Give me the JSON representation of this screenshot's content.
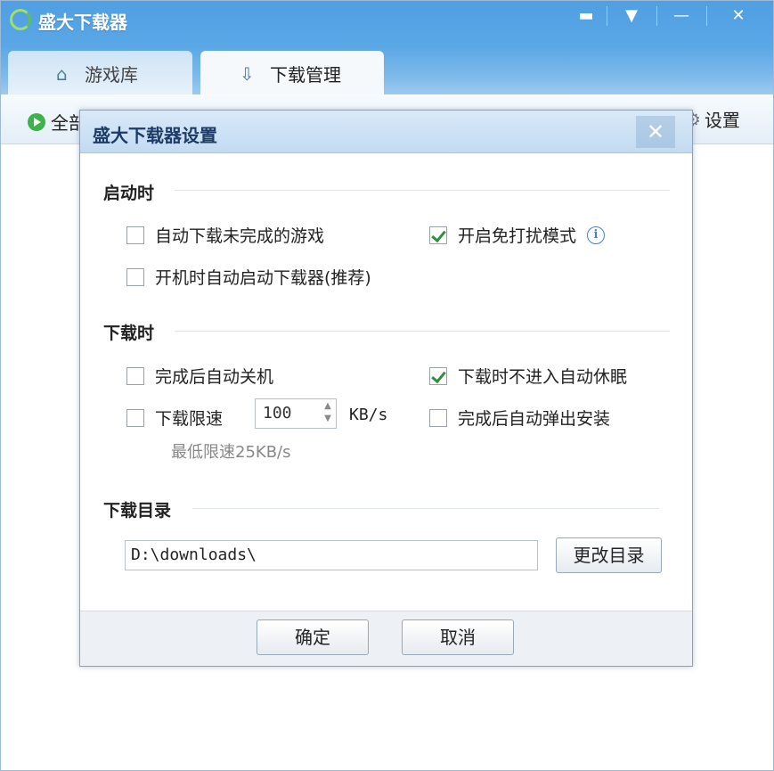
{
  "app": {
    "title": "盛大下载器",
    "tabs": [
      {
        "label": "游戏库",
        "icon": "home-icon"
      },
      {
        "label": "下载管理",
        "icon": "download-icon"
      }
    ],
    "toolbar": {
      "left_label": "全部",
      "right_label": "设置"
    }
  },
  "dialog": {
    "title": "盛大下载器设置",
    "sections": {
      "startup": {
        "heading": "启动时",
        "options": {
          "auto_download": {
            "label": "自动下载未完成的游戏",
            "checked": false
          },
          "do_not_disturb": {
            "label": "开启免打扰模式",
            "checked": true
          },
          "autostart": {
            "label": "开机时自动启动下载器(推荐)",
            "checked": false
          }
        }
      },
      "downloading": {
        "heading": "下载时",
        "options": {
          "shutdown": {
            "label": "完成后自动关机",
            "checked": false
          },
          "no_sleep": {
            "label": "下载时不进入自动休眠",
            "checked": true
          },
          "speed_limit": {
            "label": "下载限速",
            "checked": false
          },
          "auto_install": {
            "label": "完成后自动弹出安装",
            "checked": false
          }
        },
        "speed_value": "100",
        "speed_unit": "KB/s",
        "speed_hint": "最低限速25KB/s"
      },
      "directory": {
        "heading": "下载目录",
        "path": "D:\\downloads\\",
        "change_button": "更改目录"
      }
    },
    "footer": {
      "ok": "确定",
      "cancel": "取消"
    }
  }
}
